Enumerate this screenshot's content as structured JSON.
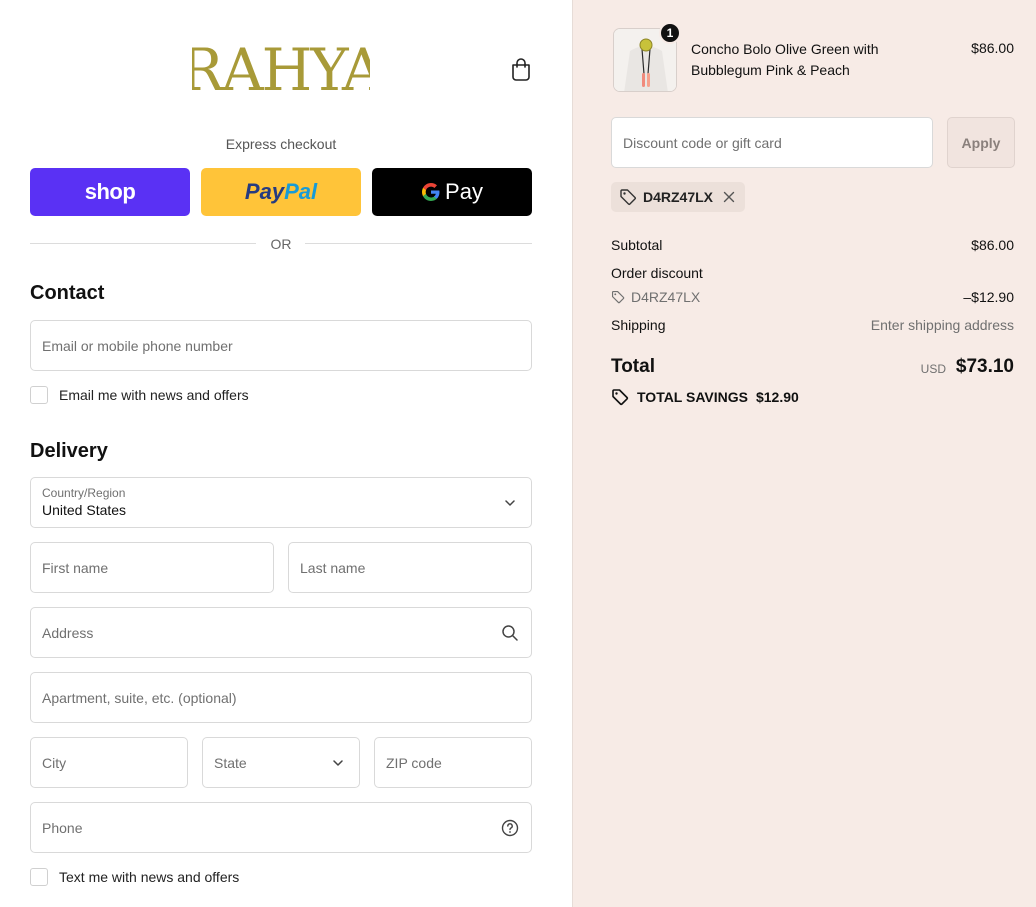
{
  "brand": {
    "logo_text": "RAHYA"
  },
  "express": {
    "title": "Express checkout",
    "shop_label": "shop",
    "paypal_part1": "Pay",
    "paypal_part2": "Pal",
    "gpay_g": "G",
    "gpay_label": "Pay",
    "or_label": "OR"
  },
  "contact": {
    "title": "Contact",
    "email_placeholder": "Email or mobile phone number",
    "news_label": "Email me with news and offers"
  },
  "delivery": {
    "title": "Delivery",
    "country_label": "Country/Region",
    "country_value": "United States",
    "first_name": "First name",
    "last_name": "Last name",
    "address": "Address",
    "apartment": "Apartment, suite, etc. (optional)",
    "city": "City",
    "state": "State",
    "zip": "ZIP code",
    "phone": "Phone",
    "text_label": "Text me with news and offers"
  },
  "cart": {
    "qty": "1",
    "product_name": "Concho Bolo Olive Green with Bubblegum Pink & Peach",
    "product_price": "$86.00",
    "discount_placeholder": "Discount code or gift card",
    "apply_label": "Apply",
    "applied_code": "D4RZ47LX"
  },
  "summary": {
    "subtotal_label": "Subtotal",
    "subtotal_value": "$86.00",
    "order_discount_label": "Order discount",
    "discount_code": "D4RZ47LX",
    "discount_value": "–$12.90",
    "shipping_label": "Shipping",
    "shipping_value": "Enter shipping address",
    "total_label": "Total",
    "currency": "USD",
    "total_value": "$73.10",
    "savings_label": "TOTAL SAVINGS",
    "savings_value": "$12.90"
  },
  "colors": {
    "shop": "#5a31f4",
    "paypal": "#ffc439",
    "gpay": "#000000",
    "logo": "#a89a38",
    "right_panel": "#f7ebe6"
  }
}
